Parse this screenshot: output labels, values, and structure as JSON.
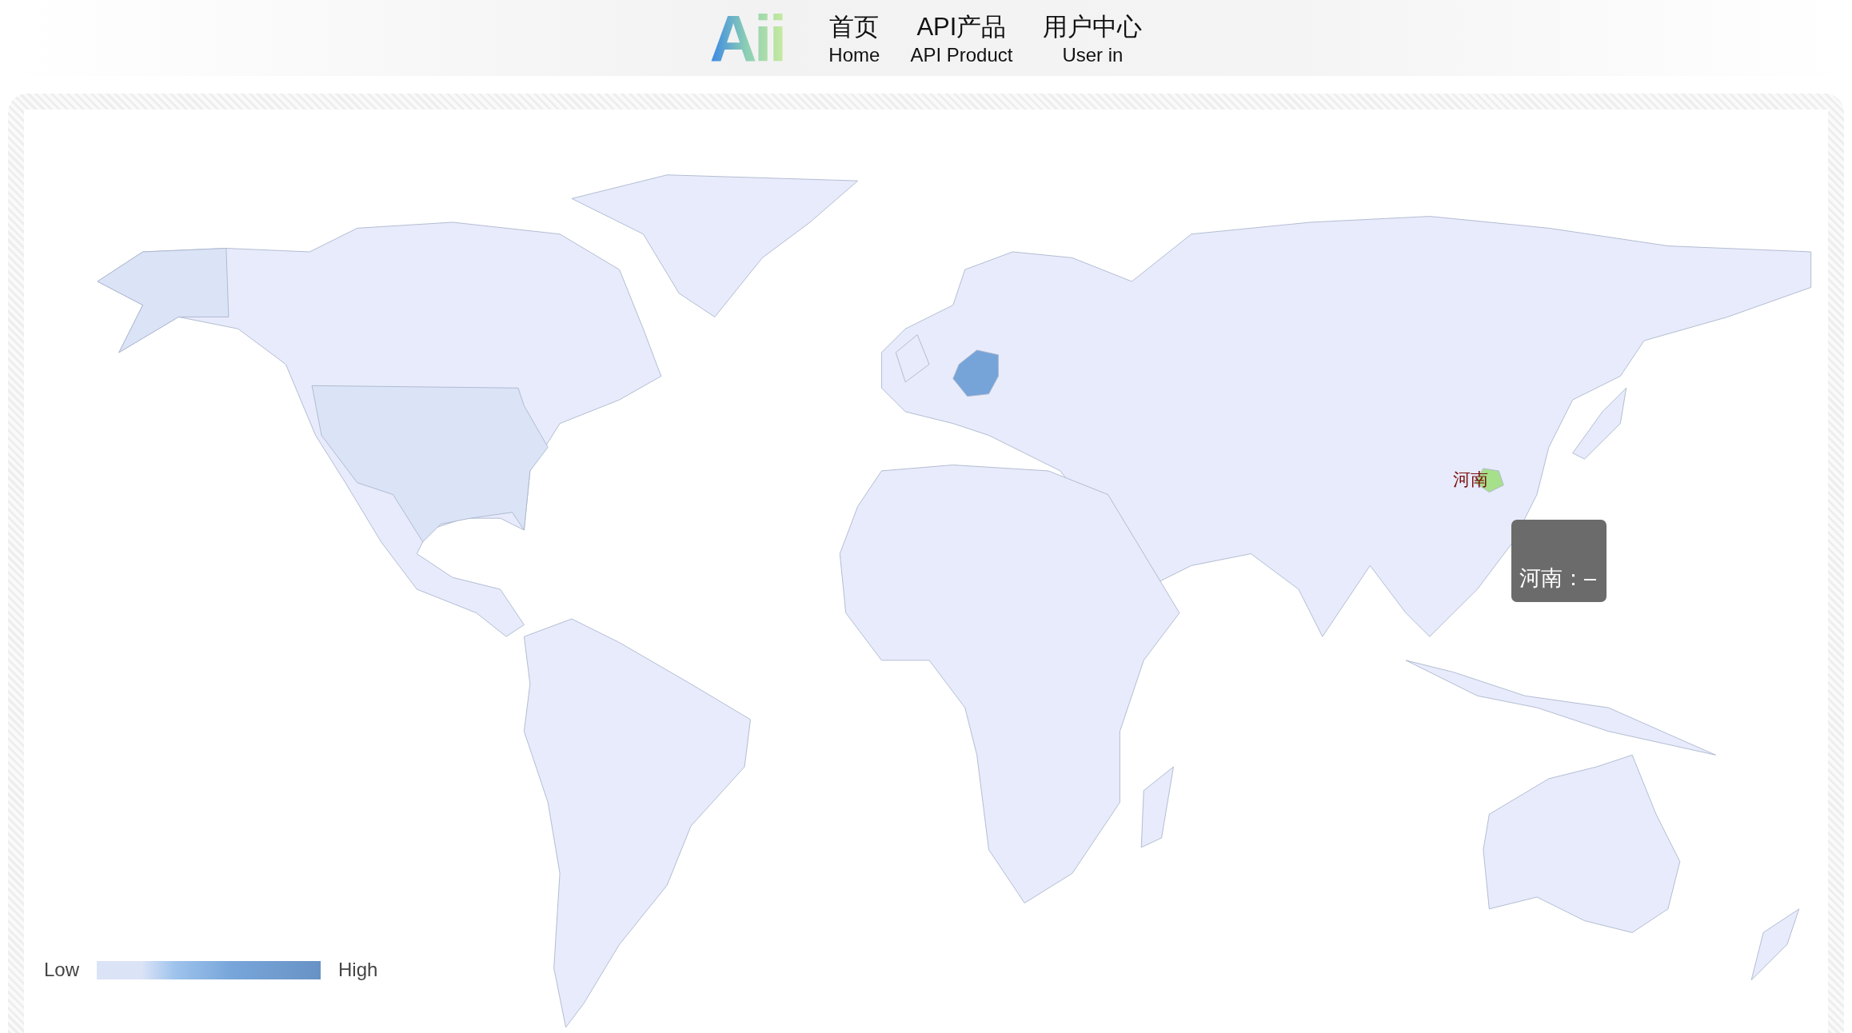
{
  "header": {
    "logo": "Aii",
    "nav": [
      {
        "title": "首页",
        "subtitle": "Home"
      },
      {
        "title": "API产品",
        "subtitle": "API Product"
      },
      {
        "title": "用户中心",
        "subtitle": "User in"
      }
    ]
  },
  "map": {
    "region_label": "河南",
    "tooltip": "河南：–",
    "legend": {
      "low": "Low",
      "high": "High"
    }
  }
}
